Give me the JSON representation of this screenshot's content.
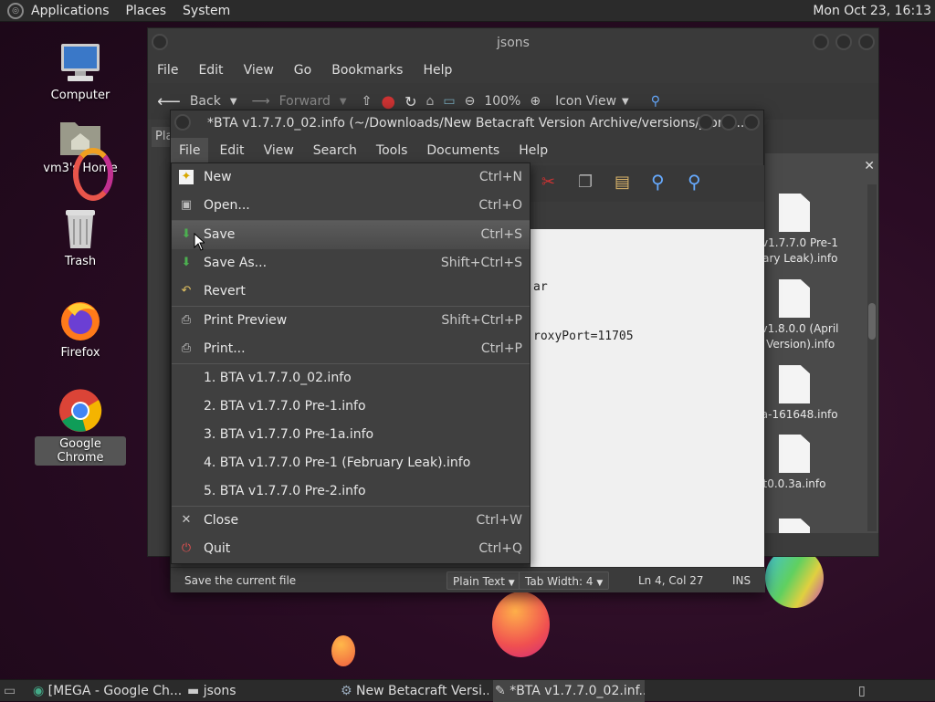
{
  "top_panel": {
    "menus": [
      "Applications",
      "Places",
      "System"
    ],
    "clock": "Mon Oct 23, 16:13"
  },
  "desktop_icons": [
    {
      "label": "Computer",
      "icon": "computer-icon"
    },
    {
      "label": "vm3's Home",
      "icon": "home-folder-icon"
    },
    {
      "label": "Trash",
      "icon": "trash-icon"
    },
    {
      "label": "Firefox",
      "icon": "firefox-icon"
    },
    {
      "label": "Google Chrome",
      "icon": "chrome-icon"
    }
  ],
  "file_manager": {
    "title": "jsons",
    "menus": [
      "File",
      "Edit",
      "View",
      "Go",
      "Bookmarks",
      "Help"
    ],
    "toolbar": {
      "back": "Back",
      "forward": "Forward",
      "zoom": "100%",
      "view_mode": "Icon View"
    },
    "sidebar_stub": "Pla",
    "files": [
      {
        "name_lines": [
          "A v1.7.7.0 Pre-1",
          "ruary Leak).info"
        ]
      },
      {
        "name_lines": [
          "A v1.8.0.0 (April",
          "ls Version).info"
        ]
      },
      {
        "name_lines": [
          ".1a-161648.info"
        ]
      },
      {
        "name_lines": [
          "t0.0.3a.info"
        ]
      }
    ]
  },
  "editor": {
    "title": "*BTA v1.7.7.0_02.info (~/Downloads/New Betacraft Version Archive/versions/jsons...",
    "menus": [
      "File",
      "Edit",
      "View",
      "Search",
      "Tools",
      "Documents",
      "Help"
    ],
    "text_lines": [
      "ar",
      "roxyPort=11705"
    ],
    "status": {
      "message": "Save the current file",
      "language": "Plain Text",
      "tab_width": "Tab Width:  4",
      "position": "Ln 4, Col 27",
      "mode": "INS"
    }
  },
  "file_menu": {
    "items": [
      {
        "label": "New",
        "shortcut": "Ctrl+N",
        "icon": "new-file-icon"
      },
      {
        "label": "Open...",
        "shortcut": "Ctrl+O",
        "icon": "open-icon"
      },
      {
        "label": "Save",
        "shortcut": "Ctrl+S",
        "icon": "save-icon"
      },
      {
        "label": "Save As...",
        "shortcut": "Shift+Ctrl+S",
        "icon": "save-as-icon"
      },
      {
        "label": "Revert",
        "shortcut": "",
        "icon": "revert-icon"
      },
      {
        "label": "Print Preview",
        "shortcut": "Shift+Ctrl+P",
        "icon": "print-preview-icon"
      },
      {
        "label": "Print...",
        "shortcut": "Ctrl+P",
        "icon": "print-icon"
      },
      {
        "label": "1.  BTA v1.7.7.0_02.info",
        "shortcut": ""
      },
      {
        "label": "2.  BTA v1.7.7.0 Pre-1.info",
        "shortcut": ""
      },
      {
        "label": "3.  BTA v1.7.7.0 Pre-1a.info",
        "shortcut": ""
      },
      {
        "label": "4.  BTA v1.7.7.0 Pre-1 (February Leak).info",
        "shortcut": ""
      },
      {
        "label": "5.  BTA v1.7.7.0 Pre-2.info",
        "shortcut": ""
      },
      {
        "label": "Close",
        "shortcut": "Ctrl+W",
        "icon": "close-icon"
      },
      {
        "label": "Quit",
        "shortcut": "Ctrl+Q",
        "icon": "quit-icon"
      }
    ]
  },
  "taskbar": {
    "items": [
      {
        "label": "[MEGA - Google Ch..."
      },
      {
        "label": "jsons"
      },
      {
        "label": "New Betacraft Versi..."
      },
      {
        "label": "*BTA v1.7.7.0_02.inf..."
      }
    ]
  }
}
